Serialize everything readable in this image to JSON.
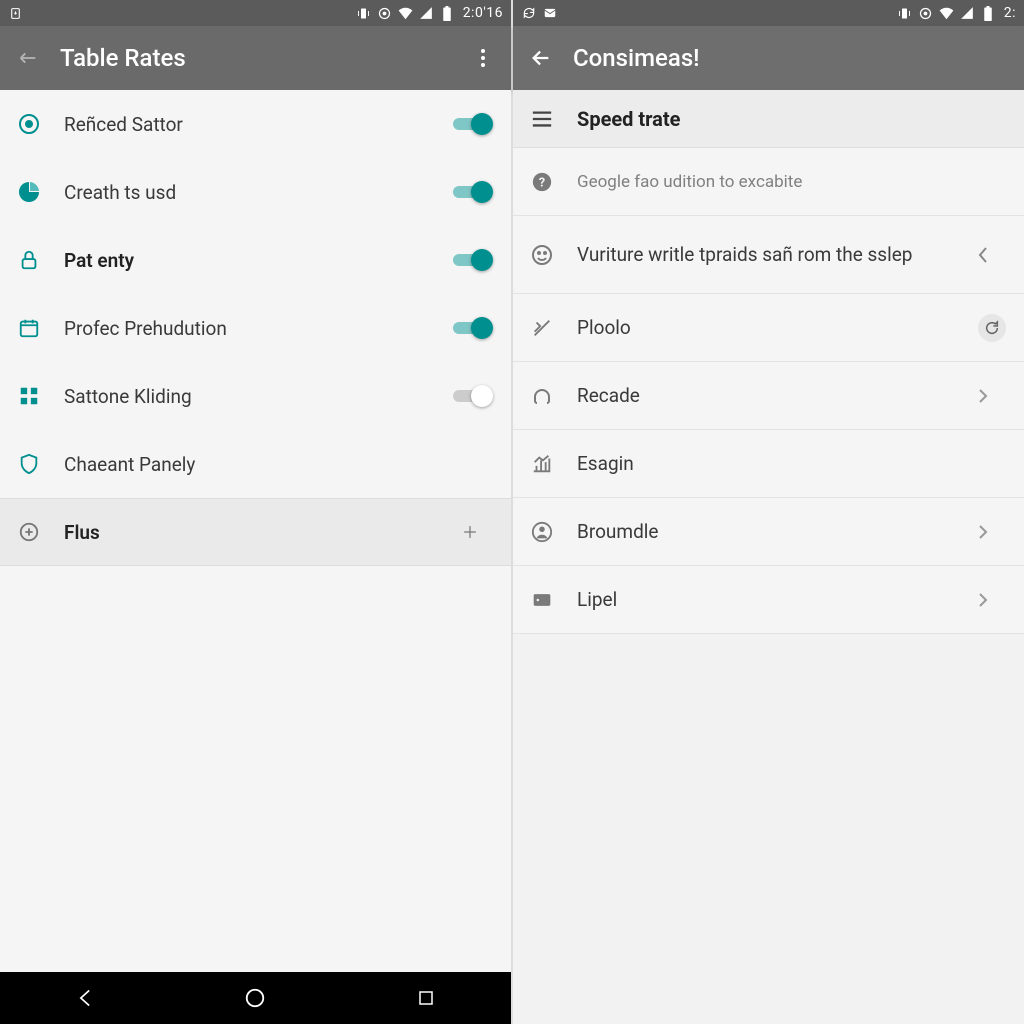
{
  "left": {
    "status": {
      "clock": "2:0'16"
    },
    "appbar": {
      "title": "Table Rates"
    },
    "items": [
      {
        "label": "Reñced Sattor",
        "bold": false,
        "toggle": true
      },
      {
        "label": "Creath ts usd",
        "bold": false,
        "toggle": true
      },
      {
        "label": "Pat enty",
        "bold": true,
        "toggle": true
      },
      {
        "label": "Profec Prehudution",
        "bold": false,
        "toggle": true
      },
      {
        "label": "Sattone Kliding",
        "bold": false,
        "toggle": false
      },
      {
        "label": "Chaeant Panely",
        "bold": false,
        "toggle": null
      }
    ],
    "flus": {
      "label": "Flus"
    }
  },
  "right": {
    "status": {
      "clock": "2:"
    },
    "appbar": {
      "title": "Consimeas!"
    },
    "header": {
      "label": "Speed trate"
    },
    "items": [
      {
        "label": "Geogle fao udition to excabite",
        "sub": true
      },
      {
        "label": "Vuriture writle tpraids sañ rom the sslep"
      },
      {
        "label": "Ploolo"
      },
      {
        "label": "Recade"
      },
      {
        "label": "Esagin"
      },
      {
        "label": "Broumdle"
      },
      {
        "label": "Lipel"
      }
    ]
  }
}
